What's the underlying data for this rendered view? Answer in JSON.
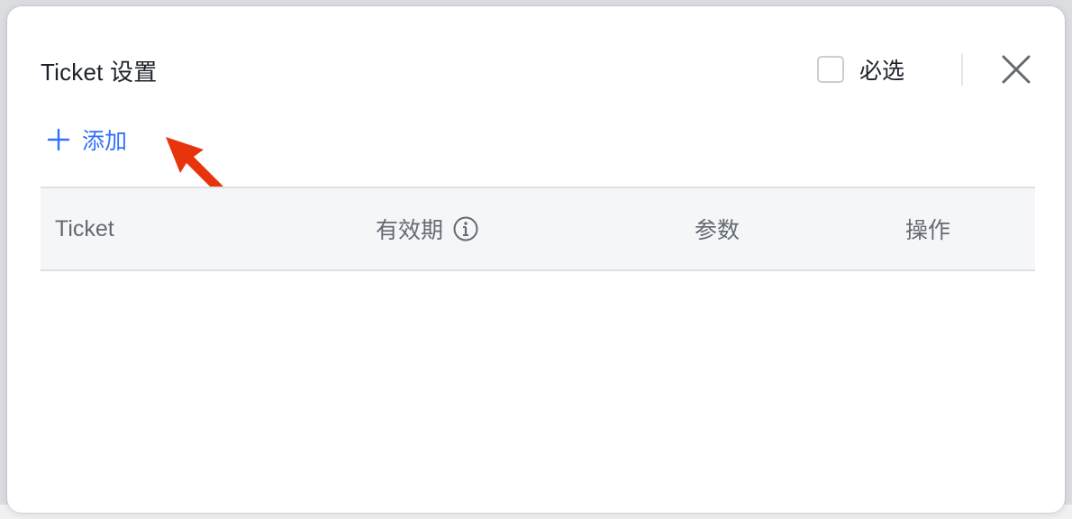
{
  "dialog": {
    "title": "Ticket 设置",
    "required_label": "必选",
    "add_label": "添加"
  },
  "table": {
    "columns": [
      "Ticket",
      "有效期",
      "参数",
      "操作"
    ]
  },
  "colors": {
    "accent": "#3370ff",
    "annotation": "#e8340c",
    "header_bg": "#f5f6f7",
    "header_text": "#646a73"
  },
  "icons": {
    "close": "close-icon",
    "add": "plus-icon",
    "info": "info-icon"
  }
}
